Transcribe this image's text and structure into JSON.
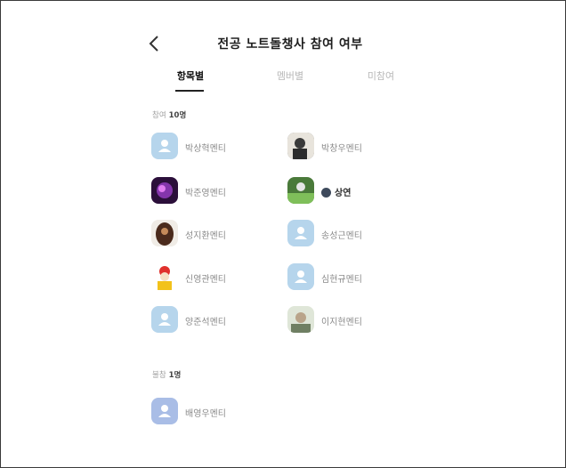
{
  "header": {
    "title": "전공 노트돌챙사 참여 여부"
  },
  "tabs": [
    {
      "label": "항목별",
      "active": true
    },
    {
      "label": "멤버별",
      "active": false
    },
    {
      "label": "미참여",
      "active": false
    }
  ],
  "sections": [
    {
      "label": "참여",
      "count": "10명",
      "members": [
        {
          "name": "박상혁멘티",
          "avatar": "default-person-icon"
        },
        {
          "name": "박창우멘티",
          "avatar": "photo-avatar"
        },
        {
          "name": "박준영멘티",
          "avatar": "photo-avatar"
        },
        {
          "name": "상연",
          "avatar": "photo-avatar",
          "badge": "owner-badge-icon"
        },
        {
          "name": "성지환멘티",
          "avatar": "photo-avatar"
        },
        {
          "name": "송성근멘티",
          "avatar": "default-person-icon"
        },
        {
          "name": "신영관멘티",
          "avatar": "photo-avatar"
        },
        {
          "name": "심현규멘티",
          "avatar": "default-person-icon"
        },
        {
          "name": "양준석멘티",
          "avatar": "default-person-icon"
        },
        {
          "name": "이지현멘티",
          "avatar": "photo-avatar"
        }
      ]
    },
    {
      "label": "불참",
      "count": "1명",
      "members": [
        {
          "name": "배영우멘티",
          "avatar": "default-person-icon"
        }
      ]
    }
  ],
  "colors": {
    "default_avatar_bg": "#b6d5ec",
    "active_tab": "#111111",
    "inactive_tab": "#b8b8b8"
  }
}
